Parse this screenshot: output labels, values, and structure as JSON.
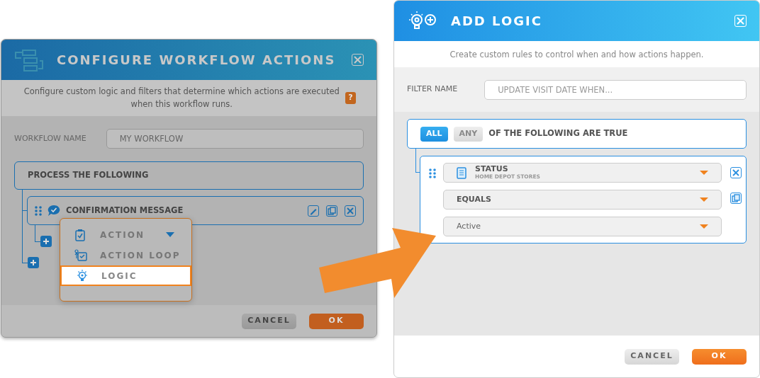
{
  "configure_dialog": {
    "title": "CONFIGURE WORKFLOW ACTIONS",
    "description": "Configure custom logic and filters that determine which actions are executed when this workflow runs.",
    "help": "?",
    "workflow_name": {
      "label": "WORKFLOW NAME",
      "value": "MY WORKFLOW"
    },
    "process_label": "PROCESS THE FOLLOWING",
    "actions": [
      {
        "title": "CONFIRMATION MESSAGE"
      }
    ],
    "add_menu": [
      {
        "label": "ACTION",
        "kind": "action",
        "expandable": true,
        "selected": false
      },
      {
        "label": "ACTION LOOP",
        "kind": "loop",
        "expandable": false,
        "selected": false
      },
      {
        "label": "LOGIC",
        "kind": "logic",
        "expandable": false,
        "selected": true
      }
    ],
    "buttons": [
      {
        "label": "CANCEL",
        "kind": "secondary"
      },
      {
        "label": "OK",
        "kind": "primary"
      }
    ]
  },
  "logic_dialog": {
    "title": "ADD LOGIC",
    "description": "Create custom rules to control when and how actions happen.",
    "filter_name": {
      "label": "FILTER NAME",
      "placeholder": "UPDATE VISIT DATE WHEN..."
    },
    "match": {
      "options": [
        {
          "label": "ALL",
          "selected": true
        },
        {
          "label": "ANY",
          "selected": false
        }
      ],
      "text": "OF THE FOLLOWING ARE TRUE"
    },
    "condition": {
      "field": "STATUS",
      "field_source": "HOME DEPOT STORES",
      "operator": "EQUALS",
      "value": "Active"
    },
    "buttons": [
      {
        "label": "CANCEL",
        "kind": "secondary"
      },
      {
        "label": "OK",
        "kind": "primary"
      }
    ]
  }
}
